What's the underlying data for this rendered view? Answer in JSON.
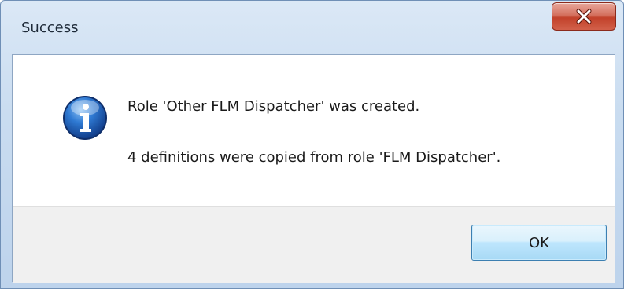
{
  "window": {
    "title": "Success",
    "close_icon": "close-icon"
  },
  "message": {
    "icon": "info-icon",
    "line1": "Role 'Other FLM Dispatcher' was created.",
    "line2": "4 definitions were copied from role 'FLM Dispatcher'."
  },
  "buttons": {
    "ok_label": "OK"
  },
  "colors": {
    "accent": "#3c7fb1",
    "close_button": "#c2412a",
    "info_icon": "#1f5fb5"
  }
}
